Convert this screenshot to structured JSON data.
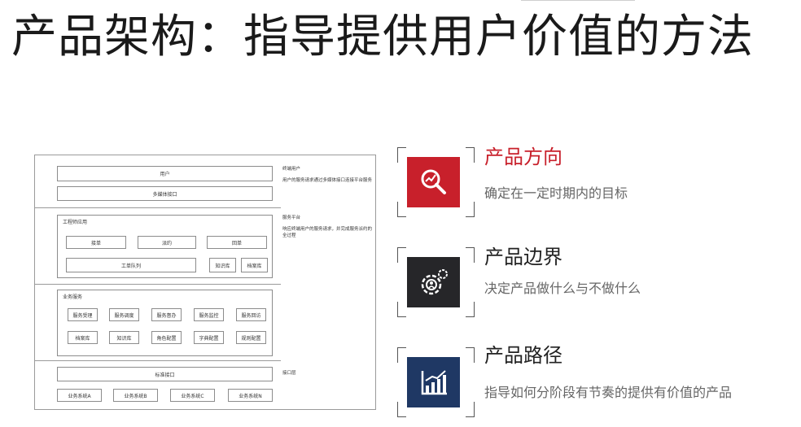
{
  "title": "产品架构：指导提供用户价值的方法",
  "architecture": {
    "user": "用户",
    "multimedia": "多媒体接口",
    "engineer_title": "工程师应用",
    "engineer_row1": [
      "接单",
      "派约",
      "回单"
    ],
    "work_queue": "工单队列",
    "knowledge": "知识库",
    "archive": "档案库",
    "middle_title": "业务服务",
    "middle_row1": [
      "服务受理",
      "服务调度",
      "服务督办",
      "服务监控",
      "服务回访"
    ],
    "middle_row2": [
      "档案库",
      "知识库",
      "角色配置",
      "字典配置",
      "规则配置"
    ],
    "standard_interface": "标准接口",
    "systems": [
      "业务系统A",
      "业务系统B",
      "业务系统C",
      "业务系统N"
    ],
    "annotations": {
      "end_user_title": "终端用户",
      "end_user_desc": "用户的服务请求通过多媒体接口连接平台服务",
      "platform_title": "服务平台",
      "platform_desc": "响应终端用户的服务请求，并完成服务派约的全过程",
      "interface_layer": "接口层"
    }
  },
  "items": [
    {
      "heading": "产品方向",
      "desc": "确定在一定时期内的目标",
      "icon": "magnifier-chart-icon",
      "tile_color": "#c8202b",
      "heading_color": "#c8202b"
    },
    {
      "heading": "产品边界",
      "desc": "决定产品做什么与不做什么",
      "icon": "gear-person-icon",
      "tile_color": "#262629",
      "heading_color": "#222222"
    },
    {
      "heading": "产品路径",
      "desc": "指导如何分阶段有节奏的提供有价值的产品",
      "icon": "bar-chart-icon",
      "tile_color": "#1f3864",
      "heading_color": "#222222"
    }
  ]
}
